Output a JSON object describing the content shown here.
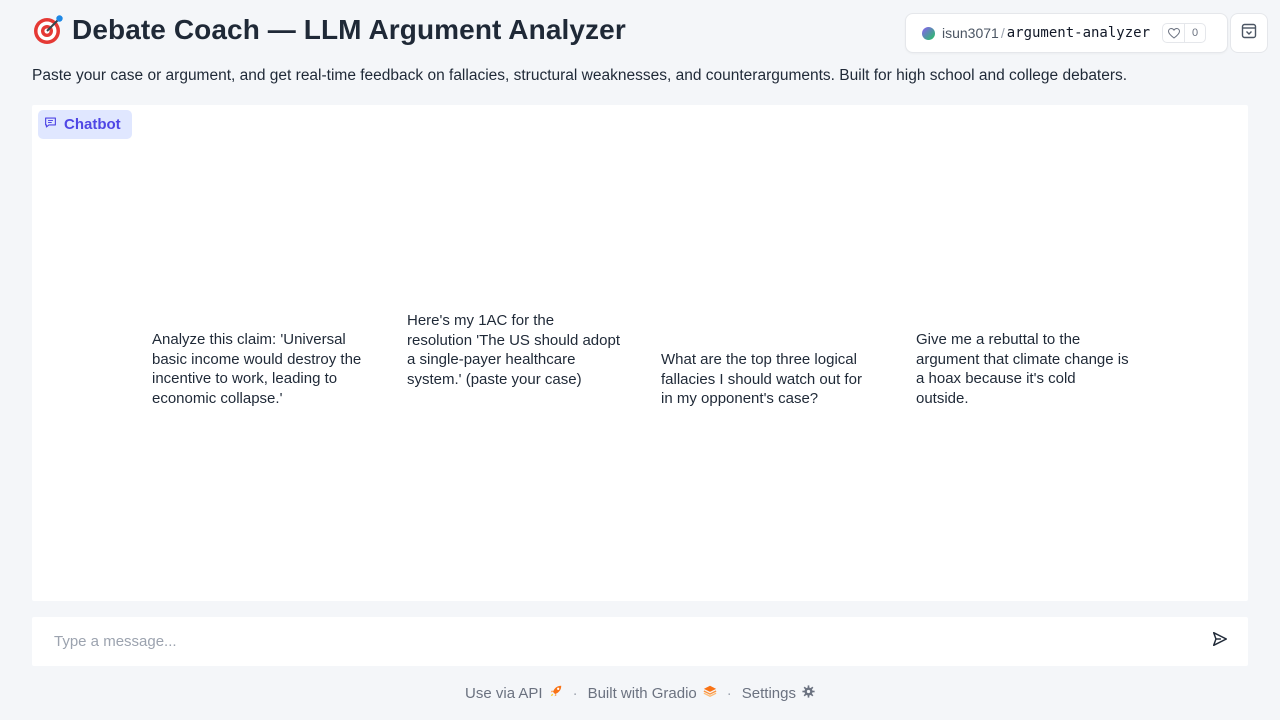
{
  "header": {
    "title": "Debate Coach — LLM Argument Analyzer",
    "subtitle": "Paste your case or argument, and get real-time feedback on fallacies, structural weaknesses, and counterarguments. Built for high school and college debaters.",
    "title_icon": "target-dart-icon"
  },
  "space": {
    "user": "isun3071",
    "separator": "/",
    "repo": "argument-analyzer",
    "likes": "0"
  },
  "chatbot": {
    "label": "Chatbot",
    "examples": [
      "Analyze this claim: 'Universal basic income would destroy the incentive to work, leading to economic collapse.'",
      "Here's my 1AC for the resolution 'The US should adopt a single-payer healthcare system.' (paste your case)",
      "What are the top three logical fallacies I should watch out for in my opponent's case?",
      "Give me a rebuttal to the argument that climate change is a hoax because it's cold outside."
    ]
  },
  "input": {
    "placeholder": "Type a message...",
    "value": ""
  },
  "footer": {
    "api": "Use via API",
    "built": "Built with Gradio",
    "settings": "Settings",
    "separator": "·"
  },
  "colors": {
    "accent": "#4f46e5",
    "label_bg": "#e0e7ff",
    "page_bg": "#f4f6f9"
  }
}
